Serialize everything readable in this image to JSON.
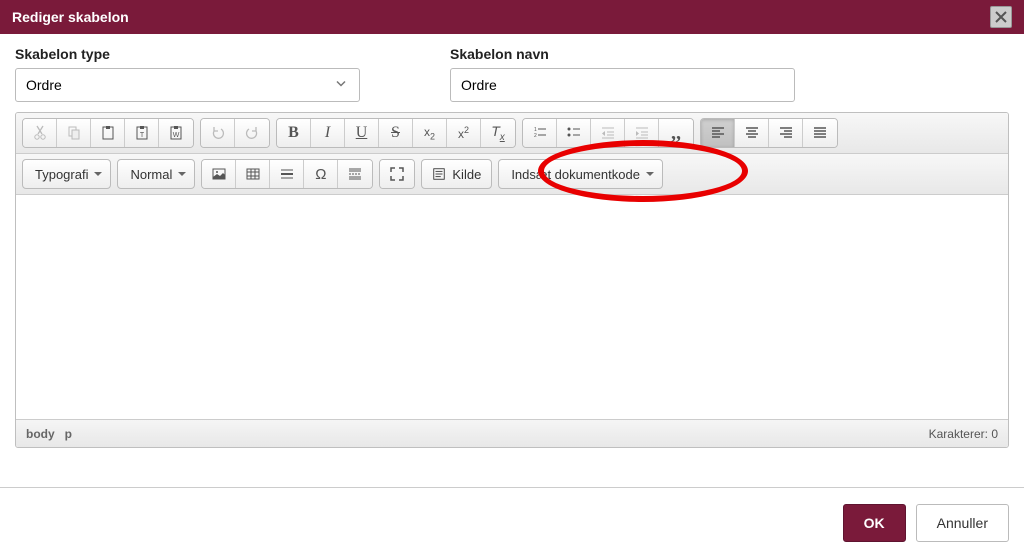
{
  "titlebar": {
    "title": "Rediger skabelon"
  },
  "form": {
    "type_label": "Skabelon type",
    "type_value": "Ordre",
    "name_label": "Skabelon navn",
    "name_value": "Ordre"
  },
  "toolbar": {
    "typografi": "Typografi",
    "normal": "Normal",
    "kilde": "Kilde",
    "insert_code": "Indsæt dokumentkode"
  },
  "status": {
    "path_body": "body",
    "path_p": "p",
    "char_label": "Karakterer:",
    "char_count": "0"
  },
  "footer": {
    "ok": "OK",
    "cancel": "Annuller"
  }
}
